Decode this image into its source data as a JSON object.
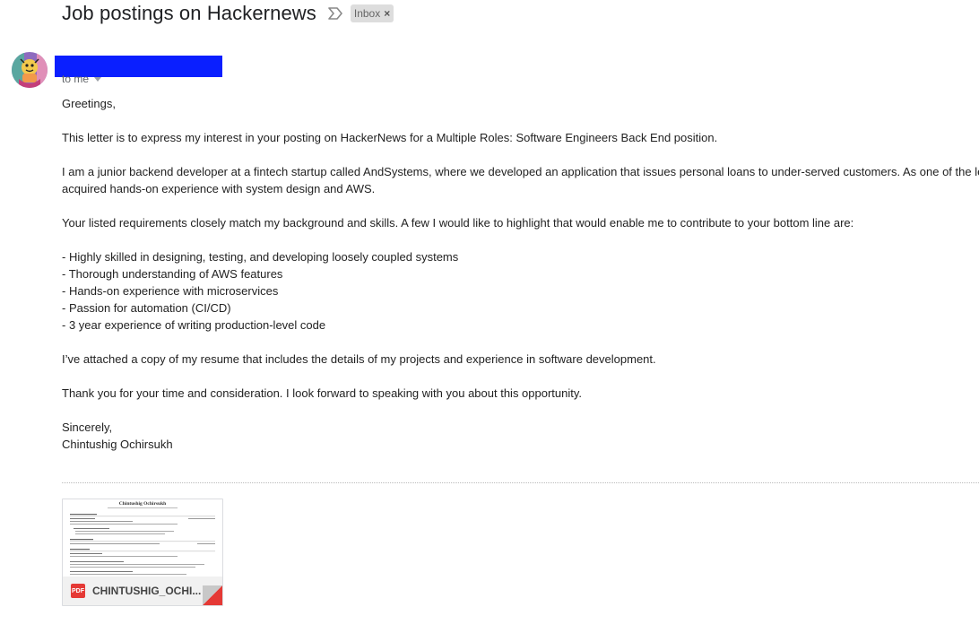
{
  "email": {
    "subject": "Job postings on Hackernews",
    "label": "Inbox",
    "label_remove": "×",
    "recipient": "to me",
    "body": [
      "Greetings,",
      "",
      "This letter is to express my interest in your posting on HackerNews for a Multiple Roles: Software Engineers Back End position.",
      "",
      "I am a junior backend developer at a fintech startup called AndSystems, where we developed an application that issues personal loans to under-served customers. As one of the le",
      "acquired hands-on experience with system design and AWS.",
      "",
      "Your listed requirements closely match my background and skills. A few I would like to highlight that would enable me to contribute to your bottom line are:",
      "",
      "- Highly skilled in designing, testing, and developing loosely coupled systems",
      "- Thorough understanding of AWS features",
      "- Hands-on experience with microservices",
      "- Passion for automation (CI/CD)",
      "- 3 year experience of writing production-level code",
      "",
      "I’ve attached a copy of my resume that includes the details of my projects and experience in software development.",
      "",
      "Thank you for your time and consideration. I look forward to speaking with you about this opportunity.",
      "",
      "Sincerely,",
      "Chintushig Ochirsukh"
    ]
  },
  "attachment": {
    "type_badge": "PDF",
    "filename": "CHINTUSHIG_OCHI...",
    "preview_name": "Chintushig Ochirsukh"
  },
  "icons": {
    "importance": "importance-marker-icon",
    "pdf": "pdf-icon",
    "caret": "chevron-down-icon",
    "avatar": "sender-avatar"
  },
  "colors": {
    "redaction": "#0a1fff",
    "pdf_red": "#e53935",
    "label_bg": "#dddddd"
  }
}
